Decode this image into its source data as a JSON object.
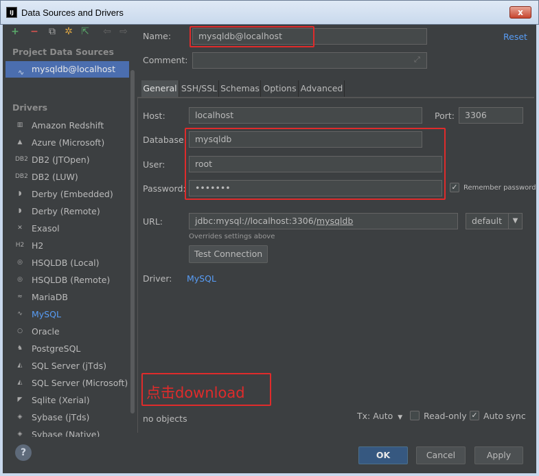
{
  "window": {
    "title": "Data Sources and Drivers",
    "app_icon": "IJ",
    "close_glyph": "x"
  },
  "toolbar": {
    "add": "+",
    "remove": "−",
    "copy": "⧉",
    "tools": "✲",
    "import": "⇱",
    "back": "⇦",
    "forward": "⇨"
  },
  "sidebar": {
    "project_header": "Project Data Sources",
    "selected_source": "mysqldb@localhost",
    "drivers_header": "Drivers",
    "drivers": [
      {
        "label": "Amazon Redshift",
        "icon": "▥"
      },
      {
        "label": "Azure (Microsoft)",
        "icon": "▲"
      },
      {
        "label": "DB2 (JTOpen)",
        "icon": "DB2"
      },
      {
        "label": "DB2 (LUW)",
        "icon": "DB2"
      },
      {
        "label": "Derby (Embedded)",
        "icon": "◗"
      },
      {
        "label": "Derby (Remote)",
        "icon": "◗"
      },
      {
        "label": "Exasol",
        "icon": "✕"
      },
      {
        "label": "H2",
        "icon": "H2"
      },
      {
        "label": "HSQLDB (Local)",
        "icon": "◎"
      },
      {
        "label": "HSQLDB (Remote)",
        "icon": "◎"
      },
      {
        "label": "MariaDB",
        "icon": "≈"
      },
      {
        "label": "MySQL",
        "icon": "∿"
      },
      {
        "label": "Oracle",
        "icon": "○"
      },
      {
        "label": "PostgreSQL",
        "icon": "♞"
      },
      {
        "label": "SQL Server (jTds)",
        "icon": "◭"
      },
      {
        "label": "SQL Server (Microsoft)",
        "icon": "◭"
      },
      {
        "label": "Sqlite (Xerial)",
        "icon": "◤"
      },
      {
        "label": "Sybase (jTds)",
        "icon": "◈"
      },
      {
        "label": "Sybase (Native)",
        "icon": "◈"
      }
    ],
    "help": "?"
  },
  "form": {
    "name_label": "Name:",
    "name_value": "mysqldb@localhost",
    "reset": "Reset",
    "comment_label": "Comment:",
    "comment_value": "",
    "expand_glyph": "⤢"
  },
  "tabs": [
    "General",
    "SSH/SSL",
    "Schemas",
    "Options",
    "Advanced"
  ],
  "general": {
    "host_label": "Host:",
    "host_value": "localhost",
    "port_label": "Port:",
    "port_value": "3306",
    "database_label": "Database:",
    "database_value": "mysqldb",
    "user_label": "User:",
    "user_value": "root",
    "password_label": "Password:",
    "password_value": "•••••••",
    "remember_label": "Remember password",
    "url_label": "URL:",
    "url_prefix": "jdbc:mysql://localhost:3306/",
    "url_db": "mysqldb",
    "url_mode": "default",
    "url_hint": "Overrides settings above",
    "test_connection": "Test Connection",
    "driver_label": "Driver:",
    "driver_value": "MySQL"
  },
  "annotation": "点击download",
  "status": {
    "objects": "no objects",
    "tx": "Tx: Auto",
    "readonly": "Read-only",
    "autosync": "Auto sync",
    "check": "✓"
  },
  "buttons": {
    "ok": "OK",
    "cancel": "Cancel",
    "apply": "Apply"
  },
  "colors": {
    "accent": "#4b6eaf",
    "link": "#589df6",
    "annotation": "#e02b2b",
    "background": "#3c3f41"
  }
}
